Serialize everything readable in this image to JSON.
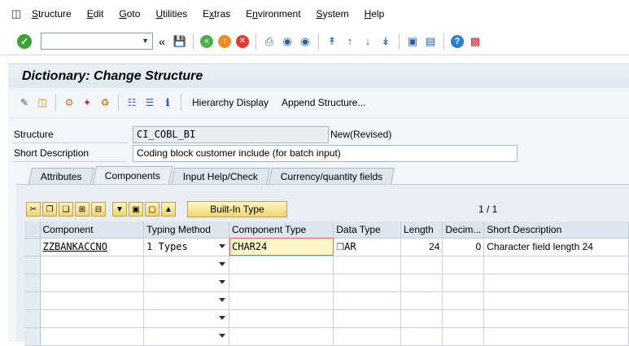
{
  "menu": {
    "items": [
      "Structure",
      "Edit",
      "Goto",
      "Utilities",
      "Extras",
      "Environment",
      "System",
      "Help"
    ],
    "underline": [
      "S",
      "E",
      "G",
      "U",
      "x",
      "n",
      "S",
      "H"
    ]
  },
  "toolbar": {
    "command_value": ""
  },
  "title": "Dictionary: Change Structure",
  "app_toolbar": {
    "hierarchy_label": "Hierarchy Display",
    "append_label": "Append Structure..."
  },
  "form": {
    "structure_label": "Structure",
    "structure_value": "CI_COBL_BI",
    "status": "New(Revised)",
    "short_desc_label": "Short Description",
    "short_desc_value": "Coding block customer include (for batch input)"
  },
  "tabs": [
    "Attributes",
    "Components",
    "Input Help/Check",
    "Currency/quantity fields"
  ],
  "grid": {
    "builtin_label": "Built-In Type",
    "pager": "1  /  1",
    "headers": [
      "Component",
      "Typing Method",
      "Component Type",
      "Data Type",
      "Length",
      "Decim...",
      "Short Description"
    ],
    "rows": [
      {
        "component": "ZZBANKACCNO",
        "typing": "1 Types",
        "comp_type": "CHAR24",
        "data_type": "AR",
        "length": "24",
        "decimals": "0",
        "short_desc": "Character field length 24"
      },
      {
        "component": "",
        "typing": "",
        "comp_type": "",
        "data_type": "",
        "length": "",
        "decimals": "",
        "short_desc": ""
      },
      {
        "component": "",
        "typing": "",
        "comp_type": "",
        "data_type": "",
        "length": "",
        "decimals": "",
        "short_desc": ""
      },
      {
        "component": "",
        "typing": "",
        "comp_type": "",
        "data_type": "",
        "length": "",
        "decimals": "",
        "short_desc": ""
      },
      {
        "component": "",
        "typing": "",
        "comp_type": "",
        "data_type": "",
        "length": "",
        "decimals": "",
        "short_desc": ""
      },
      {
        "component": "",
        "typing": "",
        "comp_type": "",
        "data_type": "",
        "length": "",
        "decimals": "",
        "short_desc": ""
      }
    ]
  }
}
